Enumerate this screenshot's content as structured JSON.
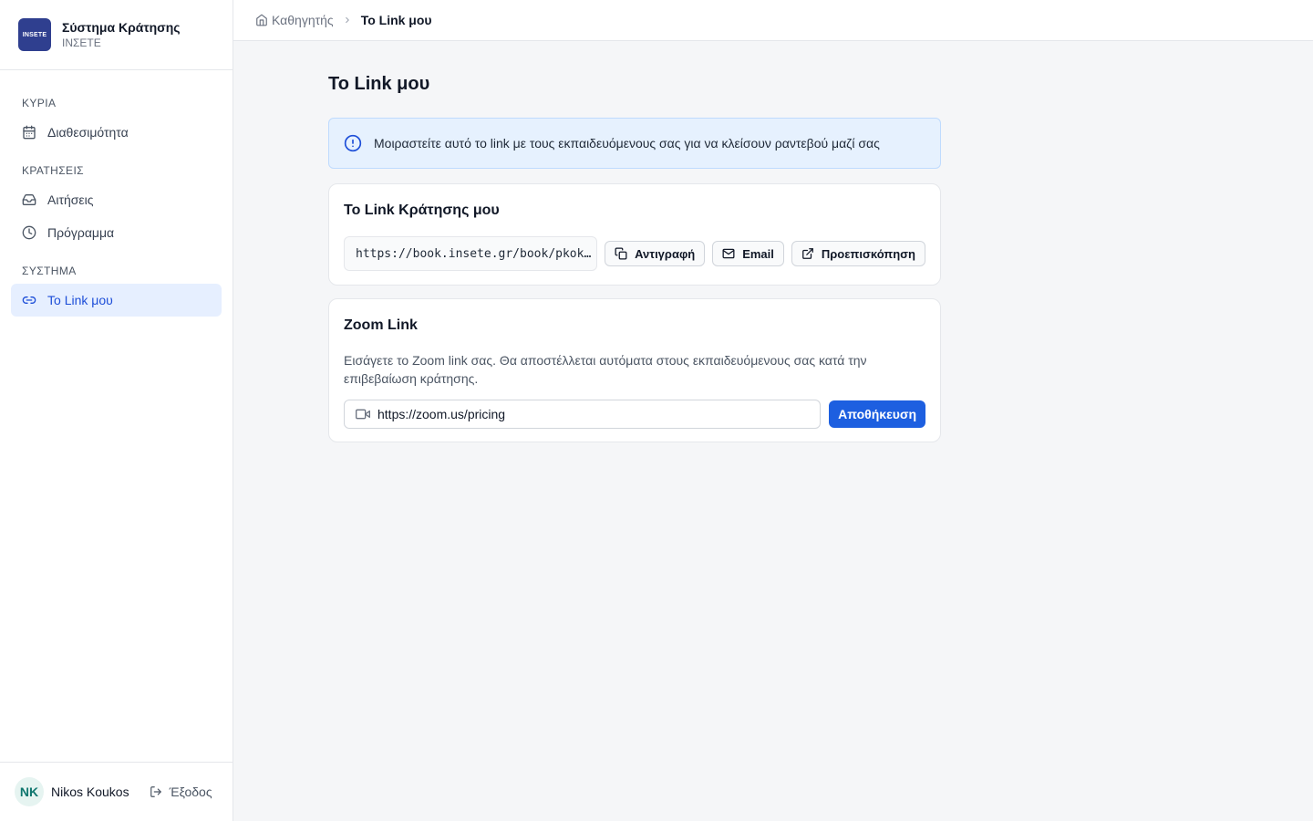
{
  "brand": {
    "logo_text": "INSETE",
    "title": "Σύστημα Κράτησης",
    "subtitle": "ΙΝΣΕΤΕ"
  },
  "sidebar": {
    "sections": [
      {
        "label": "ΚΥΡΙΑ",
        "items": [
          {
            "label": "Διαθεσιμότητα",
            "icon": "calendar-icon"
          }
        ]
      },
      {
        "label": "ΚΡΑΤΗΣΕΙΣ",
        "items": [
          {
            "label": "Αιτήσεις",
            "icon": "inbox-icon"
          },
          {
            "label": "Πρόγραμμα",
            "icon": "clock-icon"
          }
        ]
      },
      {
        "label": "ΣΥΣΤΗΜΑ",
        "items": [
          {
            "label": "Το Link μου",
            "icon": "link-icon",
            "active": true
          }
        ]
      }
    ]
  },
  "user": {
    "initials": "NK",
    "name": "Nikos Koukos",
    "logout_label": "Έξοδος"
  },
  "breadcrumb": {
    "home": "Καθηγητής",
    "current": "Το Link μου"
  },
  "page": {
    "title": "Το Link μου"
  },
  "info": {
    "text": "Μοιραστείτε αυτό το link με τους εκπαιδευόμενους σας για να κλείσουν ραντεβού μαζί σας"
  },
  "booking_link": {
    "title": "Το Link Κράτησης μου",
    "url": "https://book.insete.gr/book/pkokkalis",
    "copy_label": "Αντιγραφή",
    "email_label": "Email",
    "preview_label": "Προεπισκόπηση"
  },
  "zoom": {
    "title": "Zoom Link",
    "description": "Εισάγετε το Zoom link σας. Θα αποστέλλεται αυτόματα στους εκπαιδευόμενους σας κατά την επιβεβαίωση κράτησης.",
    "value": "https://zoom.us/pricing",
    "save_label": "Αποθήκευση"
  },
  "colors": {
    "accent": "#1d5fe0",
    "active_bg": "#e6efff",
    "info_bg": "#e6f1fe",
    "logo_bg": "#2f3f8f"
  }
}
